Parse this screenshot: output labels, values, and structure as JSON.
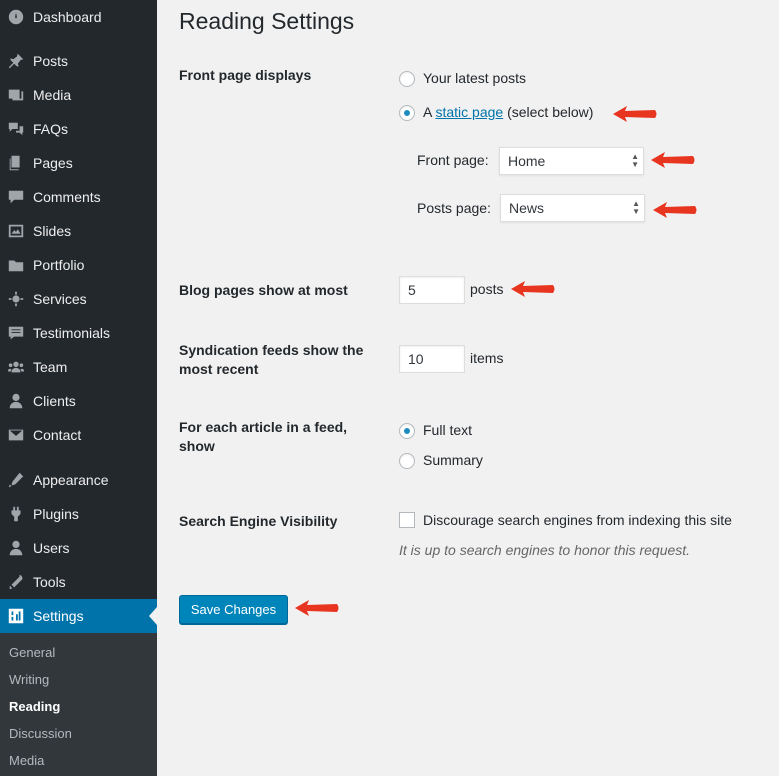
{
  "sidebar": {
    "items": [
      {
        "label": "Dashboard",
        "icon": "dashboard-icon"
      },
      {
        "label": "Posts",
        "icon": "pin-icon"
      },
      {
        "label": "Media",
        "icon": "media-icon"
      },
      {
        "label": "FAQs",
        "icon": "faq-icon"
      },
      {
        "label": "Pages",
        "icon": "pages-icon"
      },
      {
        "label": "Comments",
        "icon": "comments-icon"
      },
      {
        "label": "Slides",
        "icon": "slides-icon"
      },
      {
        "label": "Portfolio",
        "icon": "portfolio-icon"
      },
      {
        "label": "Services",
        "icon": "services-icon"
      },
      {
        "label": "Testimonials",
        "icon": "testimonials-icon"
      },
      {
        "label": "Team",
        "icon": "team-icon"
      },
      {
        "label": "Clients",
        "icon": "clients-icon"
      },
      {
        "label": "Contact",
        "icon": "contact-icon"
      },
      {
        "label": "Appearance",
        "icon": "appearance-icon"
      },
      {
        "label": "Plugins",
        "icon": "plugins-icon"
      },
      {
        "label": "Users",
        "icon": "users-icon"
      },
      {
        "label": "Tools",
        "icon": "tools-icon"
      },
      {
        "label": "Settings",
        "icon": "settings-icon"
      }
    ],
    "submenu": [
      "General",
      "Writing",
      "Reading",
      "Discussion",
      "Media"
    ]
  },
  "page": {
    "title": "Reading Settings"
  },
  "front_page": {
    "label": "Front page displays",
    "option_latest": "Your latest posts",
    "option_static_prefix": "A",
    "option_static_link": "static page",
    "option_static_suffix": "(select below)",
    "front_page_label": "Front page:",
    "front_page_value": "Home",
    "posts_page_label": "Posts page:",
    "posts_page_value": "News"
  },
  "blog_pages": {
    "label": "Blog pages show at most",
    "value": "5",
    "unit": "posts"
  },
  "syndication": {
    "label": "Syndication feeds show the most recent",
    "value": "10",
    "unit": "items"
  },
  "feed_article": {
    "label": "For each article in a feed, show",
    "option_full": "Full text",
    "option_summary": "Summary"
  },
  "visibility": {
    "label": "Search Engine Visibility",
    "checkbox_label": "Discourage search engines from indexing this site",
    "description": "It is up to search engines to honor this request."
  },
  "save_label": "Save Changes",
  "colors": {
    "sidebar_bg": "#23282d",
    "active_bg": "#0073aa",
    "button_bg": "#0085ba",
    "annotation_arrow": "#e8351f"
  }
}
